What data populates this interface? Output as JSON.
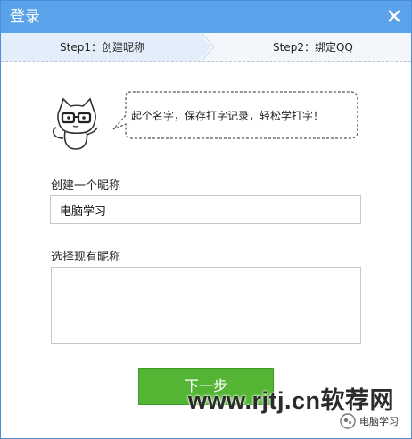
{
  "window": {
    "title": "登录"
  },
  "steps": [
    {
      "label": "Step1：创建昵称"
    },
    {
      "label": "Step2：绑定QQ"
    }
  ],
  "mascot": {
    "speech": "起个名字，保存打字记录，轻松学打字！"
  },
  "nickname": {
    "label": "创建一个昵称",
    "value": "电脑学习"
  },
  "existing": {
    "label": "选择现有昵称",
    "items": []
  },
  "actions": {
    "next_label": "下一步"
  },
  "watermark": {
    "site": "www.rjtj.cn软荐网",
    "account": "电脑学习"
  },
  "colors": {
    "titlebar": "#5aa3ea",
    "primary_button": "#53b533",
    "step_active_bg": "#e4eefa"
  }
}
